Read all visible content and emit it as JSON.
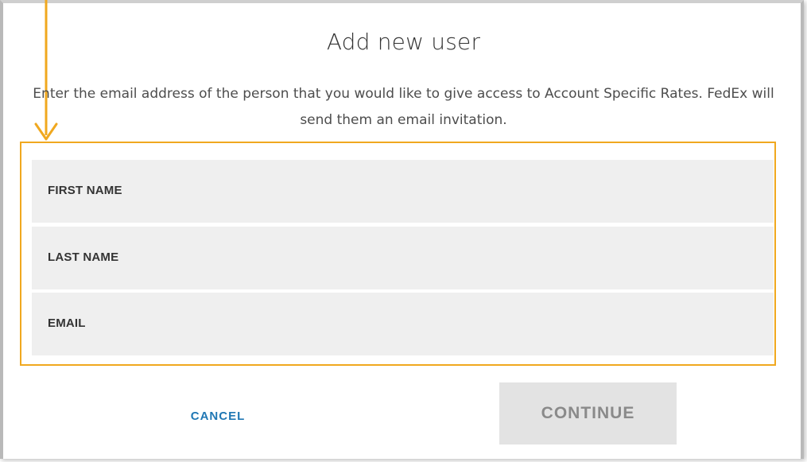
{
  "dialog": {
    "title": "Add new user",
    "description": "Enter the email address of the person that you would like to give access to Account Specific Rates. FedEx will send them an email invitation."
  },
  "form": {
    "fields": [
      {
        "label": "FIRST NAME",
        "value": ""
      },
      {
        "label": "LAST NAME",
        "value": ""
      },
      {
        "label": "EMAIL",
        "value": ""
      }
    ]
  },
  "actions": {
    "cancel_label": "CANCEL",
    "continue_label": "CONTINUE"
  },
  "colors": {
    "highlight": "#f0a81f",
    "link_blue": "#1f77b4",
    "field_bg": "#efefef",
    "button_disabled_bg": "#e3e3e3"
  },
  "icons": {
    "annotation_arrow": "down-arrow-icon"
  }
}
